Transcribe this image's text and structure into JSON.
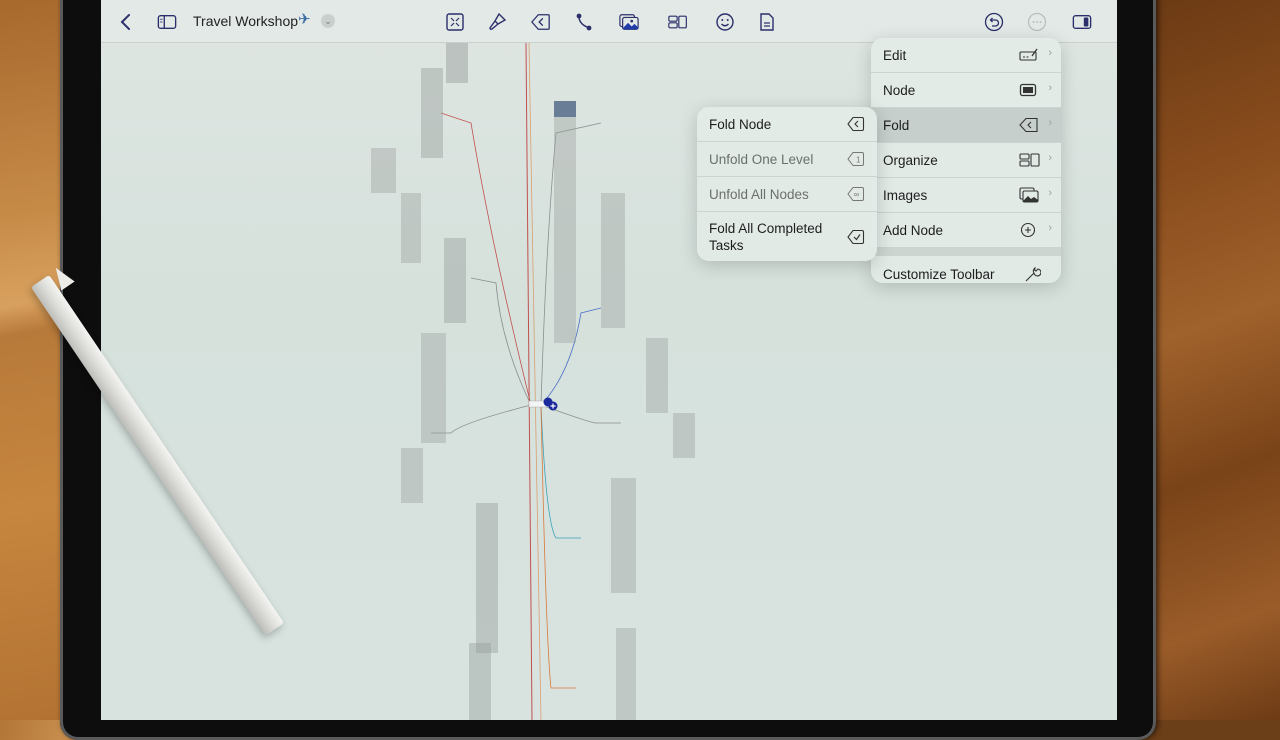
{
  "toolbar": {
    "back_icon": "chevron-left",
    "sidebar_icon": "sidebar-left",
    "document_title": "Travel Workshop",
    "title_emoji": "✈",
    "title_menu_icon": "chevron-down-circle",
    "tools": [
      {
        "name": "focus",
        "icon": "focus-collapse-icon"
      },
      {
        "name": "style",
        "icon": "paintbrush-icon"
      },
      {
        "name": "fold",
        "icon": "fold-icon"
      },
      {
        "name": "connection",
        "icon": "connection-icon"
      },
      {
        "name": "images",
        "icon": "photo-stack-icon"
      },
      {
        "name": "organize",
        "icon": "layout-icon"
      },
      {
        "name": "emoji",
        "icon": "smiley-icon"
      },
      {
        "name": "document",
        "icon": "document-icon"
      }
    ],
    "right": [
      {
        "name": "undo",
        "icon": "undo-icon"
      },
      {
        "name": "more",
        "icon": "ellipsis-circle-icon"
      },
      {
        "name": "inspector",
        "icon": "sidebar-right-icon"
      }
    ]
  },
  "main_menu": {
    "items": [
      {
        "label": "Edit",
        "icon": "pencil-line-icon",
        "has_submenu": true
      },
      {
        "label": "Node",
        "icon": "node-box-icon",
        "has_submenu": true
      },
      {
        "label": "Fold",
        "icon": "fold-icon",
        "has_submenu": true,
        "active": true
      },
      {
        "label": "Organize",
        "icon": "layout-icon",
        "has_submenu": true
      },
      {
        "label": "Images",
        "icon": "photo-stack-icon",
        "has_submenu": true
      },
      {
        "label": "Add Node",
        "icon": "plus-circle-icon",
        "has_submenu": true
      }
    ],
    "footer_item": {
      "label": "Customize Toolbar",
      "icon": "wrench-icon"
    }
  },
  "fold_submenu": {
    "items": [
      {
        "label": "Fold Node",
        "icon": "fold-icon",
        "enabled": true
      },
      {
        "label": "Unfold One Level",
        "icon": "unfold-one-icon",
        "enabled": false
      },
      {
        "label": "Unfold All Nodes",
        "icon": "unfold-all-icon",
        "enabled": false
      },
      {
        "label": "Fold All Completed Tasks",
        "icon": "fold-check-icon",
        "enabled": true
      }
    ]
  },
  "colors": {
    "accent": "#2b2f6b",
    "selection": "#1a2a9c",
    "branch_red": "#c0504d",
    "branch_blue": "#4a72c4",
    "branch_teal": "#3aa0b8",
    "branch_orange": "#d9793a",
    "branch_gray": "#8a8f8d"
  }
}
